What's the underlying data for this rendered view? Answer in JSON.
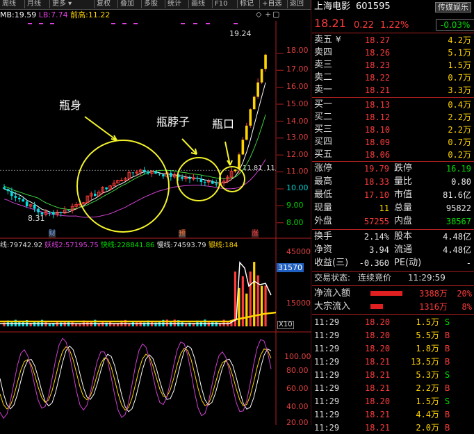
{
  "toolbar": {
    "buttons": [
      "周线",
      "月线",
      "更多 ▾",
      "复权",
      "叠加",
      "多股",
      "统计",
      "画线",
      "F10",
      "标记",
      "+自选",
      "返回"
    ]
  },
  "header": {
    "ind_prefix": "MB:",
    "mb_value": "19.59",
    "lb_label": "LB:",
    "lb_value": "7.74",
    "prev_high_label": "前高:",
    "prev_high_value": "11.22"
  },
  "chart": {
    "axis_labels": [
      "18.00",
      "17.00",
      "16.00",
      "15.00",
      "14.00",
      "13.00",
      "12.00",
      "11.00",
      "10.00",
      "9.00",
      "8.00"
    ],
    "peak_label": "19.24",
    "low_label": "8.31",
    "level_label": "11.81",
    "level_label2": "11",
    "annotations": {
      "body": "瓶身",
      "neck": "瓶脖子",
      "mouth": "瓶口"
    },
    "markers": {
      "cai": "财",
      "yu": "预",
      "zhang": "涨"
    }
  },
  "vol_panel": {
    "legend": [
      {
        "label": "线:",
        "value": "79742.92"
      },
      {
        "label": "妖线2:",
        "value": "57195.75"
      },
      {
        "label": "快线:",
        "value": "228841.86"
      },
      {
        "label": "慢线:",
        "value": "74593.79"
      },
      {
        "label": "银线:",
        "value": "184"
      }
    ],
    "axis": [
      "45000",
      "15000"
    ],
    "highlight": "31570",
    "unit": "X10"
  },
  "osc_panel": {
    "axis": [
      "100.00",
      "80.00",
      "60.00",
      "40.00",
      "20.00"
    ]
  },
  "colors": {
    "up": "#ff3b3b",
    "down": "#00e000",
    "accent": "#ffd400",
    "bg": "#000000"
  },
  "quote": {
    "name": "上海电影",
    "code": "601595",
    "sector_btn": "传媒娱乐",
    "sector_change": "-0.03%",
    "price": "18.21",
    "change": "0.22",
    "pct": "1.22%",
    "asks": [
      {
        "label": "卖五",
        "flag": "¥",
        "price": "18.27",
        "vol": "4.2万"
      },
      {
        "label": "卖四",
        "flag": "",
        "price": "18.26",
        "vol": "5.1万"
      },
      {
        "label": "卖三",
        "flag": "",
        "price": "18.23",
        "vol": "1.5万"
      },
      {
        "label": "卖二",
        "flag": "",
        "price": "18.22",
        "vol": "0.7万"
      },
      {
        "label": "卖一",
        "flag": "",
        "price": "18.21",
        "vol": "3.3万"
      }
    ],
    "bids": [
      {
        "label": "买一",
        "price": "18.13",
        "vol": "0.4万"
      },
      {
        "label": "买二",
        "price": "18.12",
        "vol": "2.2万"
      },
      {
        "label": "买三",
        "price": "18.10",
        "vol": "2.2万"
      },
      {
        "label": "买四",
        "price": "18.09",
        "vol": "0.7万"
      },
      {
        "label": "买五",
        "price": "18.06",
        "vol": "0.2万"
      }
    ],
    "stats": [
      {
        "l1": "涨停",
        "v1": "19.79",
        "c1": "red",
        "l2": "跌停",
        "v2": "16.19",
        "c2": "green"
      },
      {
        "l1": "最高",
        "v1": "18.33",
        "c1": "red",
        "l2": "量比",
        "v2": "0.80",
        "c2": "white"
      },
      {
        "l1": "最低",
        "v1": "17.10",
        "c1": "red",
        "l2": "市值",
        "v2": "81.6亿",
        "c2": "white"
      },
      {
        "l1": "现量",
        "v1": "11",
        "c1": "yellow",
        "l2": "总量",
        "v2": "95822",
        "c2": "white"
      },
      {
        "l1": "外盘",
        "v1": "57255",
        "c1": "red",
        "l2": "内盘",
        "v2": "38567",
        "c2": "green"
      }
    ],
    "stats2": [
      {
        "l1": "换手",
        "v1": "2.14%",
        "c1": "white",
        "l2": "股本",
        "v2": "4.48亿",
        "c2": "white"
      },
      {
        "l1": "净资",
        "v1": "3.94",
        "c1": "white",
        "l2": "流通",
        "v2": "4.48亿",
        "c2": "white"
      },
      {
        "l1": "收益(三)",
        "v1": "-0.360",
        "c1": "white",
        "l2": "PE(动)",
        "v2": "-",
        "c2": "white"
      }
    ],
    "trade_status_label": "交易状态:",
    "trade_status": "连续竞价",
    "trade_time": "11:29:59",
    "flows": [
      {
        "label": "净流入额",
        "amount": "3388万",
        "pct": "20%",
        "fill": 0.2
      },
      {
        "label": "大宗流入",
        "amount": "1316万",
        "pct": "8%",
        "fill": 0.08
      }
    ],
    "ticks": [
      {
        "time": "11:29",
        "price": "18.20",
        "vol": "1.5万",
        "side": "S"
      },
      {
        "time": "11:29",
        "price": "18.20",
        "vol": "5.5万",
        "side": "B"
      },
      {
        "time": "11:29",
        "price": "18.20",
        "vol": "1.8万",
        "side": "B"
      },
      {
        "time": "11:29",
        "price": "18.21",
        "vol": "13.5万",
        "side": "B"
      },
      {
        "time": "11:29",
        "price": "18.21",
        "vol": "5.3万",
        "side": "S"
      },
      {
        "time": "11:29",
        "price": "18.21",
        "vol": "2.2万",
        "side": "B"
      },
      {
        "time": "11:29",
        "price": "18.20",
        "vol": "1.5万",
        "side": "S"
      },
      {
        "time": "11:29",
        "price": "18.21",
        "vol": "4.4万",
        "side": "B"
      },
      {
        "time": "11:29",
        "price": "18.21",
        "vol": "2.0万",
        "side": "B"
      }
    ]
  }
}
